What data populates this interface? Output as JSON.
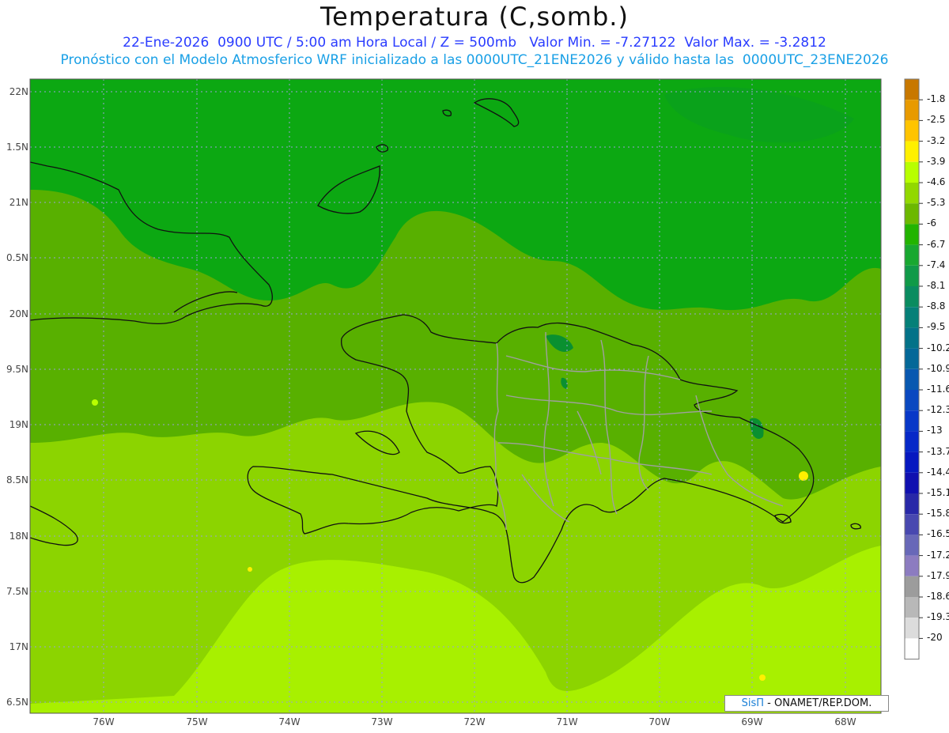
{
  "header": {
    "title": "Temperatura (C,somb.)",
    "line1": "22-Ene-2026  0900 UTC / 5:00 am Hora Local / Z = 500mb   Valor Min. = -7.27122  Valor Max. = -3.2812",
    "line2": "Pronóstico con el Modelo Atmosferico WRF inicializado a las 0000UTC_21ENE2026 y válido hasta las  0000UTC_23ENE2026"
  },
  "axes": {
    "lat_labels": [
      "22N",
      "1.5N",
      "21N",
      "0.5N",
      "20N",
      "9.5N",
      "19N",
      "8.5N",
      "18N",
      "7.5N",
      "17N",
      "6.5N"
    ],
    "lon_labels": [
      "76W",
      "75W",
      "74W",
      "73W",
      "72W",
      "71W",
      "70W",
      "69W",
      "68W"
    ]
  },
  "colorbar": {
    "labels": [
      "-1.8",
      "-2.5",
      "-3.2",
      "-3.9",
      "-4.6",
      "-5.3",
      "-6",
      "-6.7",
      "-7.4",
      "-8.1",
      "-8.8",
      "-9.5",
      "-10.2",
      "-10.9",
      "-11.6",
      "-12.3",
      "-13",
      "-13.7",
      "-14.4",
      "-15.1",
      "-15.8",
      "-16.5",
      "-17.2",
      "-17.9",
      "-18.6",
      "-19.3",
      "-20"
    ],
    "colors": [
      "#c87800",
      "#e89a00",
      "#ffc400",
      "#fff000",
      "#b8ff00",
      "#92d800",
      "#6cb800",
      "#22b400",
      "#18a830",
      "#109a48",
      "#0a8c60",
      "#058078",
      "#037288",
      "#046898",
      "#0858b0",
      "#0a48c0",
      "#0838c8",
      "#0628c8",
      "#0618c0",
      "#1010b0",
      "#2828a8",
      "#4848b0",
      "#6868b8",
      "#8c7cc0",
      "#9c9c9c",
      "#b8b8b8",
      "#dcdcdc"
    ]
  },
  "field_colors": {
    "north": "#0ca812",
    "mid": "#58b000",
    "south_mid": "#8cd400",
    "south": "#a8f000",
    "land_border": "#111111",
    "province_border": "#a0a0a0",
    "grid": "#9aa0d8"
  },
  "credit": {
    "brand": "SisΠ",
    "text": " - ONAMET/REP.DOM."
  }
}
